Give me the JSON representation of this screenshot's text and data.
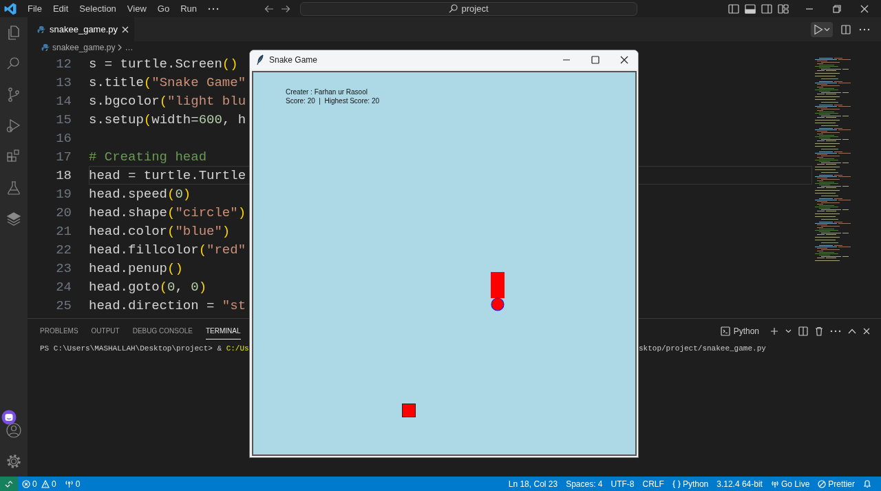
{
  "title_bar": {
    "menu": [
      "File",
      "Edit",
      "Selection",
      "View",
      "Go",
      "Run"
    ],
    "search": {
      "label": "project"
    }
  },
  "editor": {
    "tabs": [
      {
        "label": "snakee_game.py",
        "selected": true
      }
    ],
    "breadcrumb": [
      "snakee_game.py",
      "…"
    ],
    "lines": [
      {
        "number": "12",
        "code": "s = turtle.Screen()",
        "current": false
      },
      {
        "number": "13",
        "code": "s.title(\"Snake Game\"",
        "current": false
      },
      {
        "number": "14",
        "code": "s.bgcolor(\"light blu",
        "current": false
      },
      {
        "number": "15",
        "code": "s.setup(width=600, h",
        "current": false
      },
      {
        "number": "16",
        "current": false
      },
      {
        "number": "17",
        "code": "# Creating head",
        "current": false
      },
      {
        "number": "18",
        "code": "head = turtle.Turtle",
        "current": true
      },
      {
        "number": "19",
        "code": "head.speed(0)",
        "current": false
      },
      {
        "number": "20",
        "code": "head.shape(\"circle\")",
        "current": false
      },
      {
        "number": "21",
        "code": "head.color(\"blue\")",
        "current": false
      },
      {
        "number": "22",
        "code": "head.fillcolor(\"red\"",
        "current": false
      },
      {
        "number": "23",
        "code": "head.penup()",
        "current": false
      },
      {
        "number": "24",
        "code": "head.goto(0, 0)",
        "current": false
      },
      {
        "number": "25",
        "code": "head.direction = \"st",
        "current": false
      }
    ]
  },
  "panel": {
    "tabs": [
      {
        "label": "PROBLEMS",
        "selected": false
      },
      {
        "label": "OUTPUT",
        "selected": false
      },
      {
        "label": "DEBUG CONSOLE",
        "selected": false
      },
      {
        "label": "TERMINAL",
        "selected": true
      }
    ],
    "terminal_profile": "Python",
    "terminal": {
      "prompt": "PS C:\\Users\\MASHALLAH\\Desktop\\project>",
      "operator": "&",
      "path": "C:/Us",
      "continuation": "sktop/project/snakee_game.py"
    }
  },
  "game_window": {
    "title": "Snake Game",
    "creator": "Creater : Farhan ur Rasool",
    "score": "Score: 20  |  Highest Score: 20"
  },
  "status_bar": {
    "errors": "0",
    "warnings": "0",
    "ports": "0",
    "items": [
      {
        "kind": "text",
        "text": "Ln 18, Col 23"
      },
      {
        "kind": "text",
        "text": "Spaces: 4"
      },
      {
        "kind": "text",
        "text": "UTF-8"
      },
      {
        "kind": "text",
        "text": "CRLF"
      },
      {
        "kind": "braces",
        "text": "Python"
      },
      {
        "kind": "text",
        "text": "3.12.4 64-bit"
      },
      {
        "kind": "broadcast",
        "text": "Go Live"
      },
      {
        "kind": "blocked",
        "text": "Prettier"
      },
      {
        "kind": "bell"
      }
    ]
  }
}
